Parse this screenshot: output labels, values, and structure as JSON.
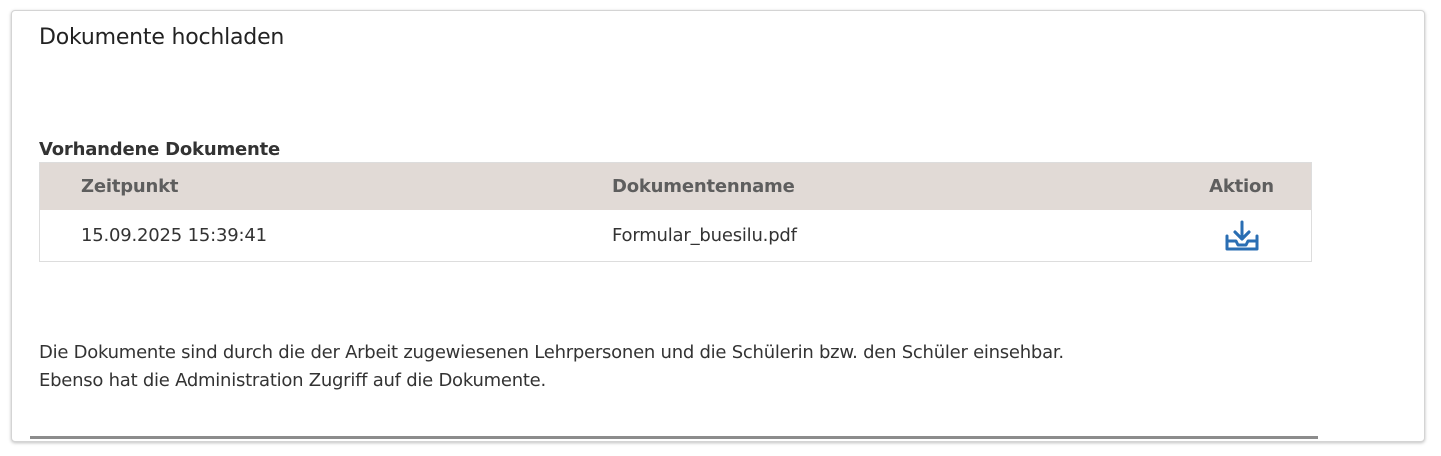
{
  "panel": {
    "title": "Dokumente hochladen"
  },
  "documents": {
    "section_title": "Vorhandene Dokumente",
    "columns": {
      "time": "Zeitpunkt",
      "name": "Dokumentenname",
      "action": "Aktion"
    },
    "rows": [
      {
        "time": "15.09.2025 15:39:41",
        "name": "Formular_buesilu.pdf",
        "action_icon": "download-icon"
      }
    ]
  },
  "info": {
    "line1": "Die Dokumente sind durch die der Arbeit zugewiesenen Lehrpersonen und die Schülerin bzw. den Schüler einsehbar.",
    "line2": "Ebenso hat die Administration Zugriff auf die Dokumente."
  },
  "colors": {
    "table_header_bg": "#e1dad6",
    "icon_blue": "#2a6eb3"
  }
}
